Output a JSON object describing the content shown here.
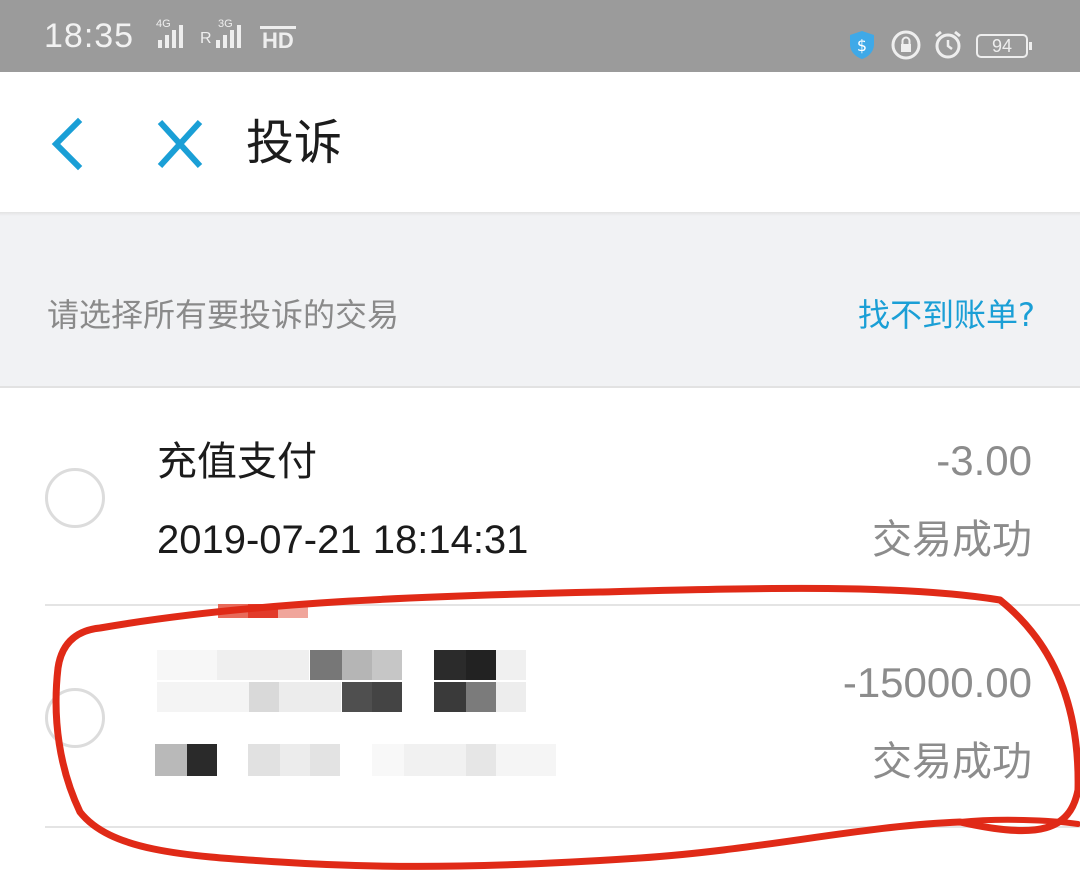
{
  "status_bar": {
    "time": "18:35",
    "signal_1_network": "4G",
    "signal_2_network": "3G",
    "signal_2_roaming": "R",
    "hd_label": "HD",
    "battery_level": "94",
    "icons": [
      "shield-icon",
      "vpn-lock-icon",
      "alarm-icon",
      "battery-icon"
    ]
  },
  "header": {
    "title": "投诉"
  },
  "section": {
    "hint": "请选择所有要投诉的交易",
    "not_found_link": "找不到账单?"
  },
  "transactions": [
    {
      "title": "充值支付",
      "time": "2019-07-21 18:14:31",
      "amount": "-3.00",
      "status": "交易成功",
      "selected": false
    },
    {
      "title": "",
      "time": "",
      "amount": "-15000.00",
      "status": "交易成功",
      "selected": false,
      "details_pixelated": true
    }
  ],
  "colors": {
    "accent": "#1a9fd6",
    "status_bar": "#9b9b9b",
    "section_bg": "#f1f2f4",
    "annotation_red": "#e02a17"
  }
}
